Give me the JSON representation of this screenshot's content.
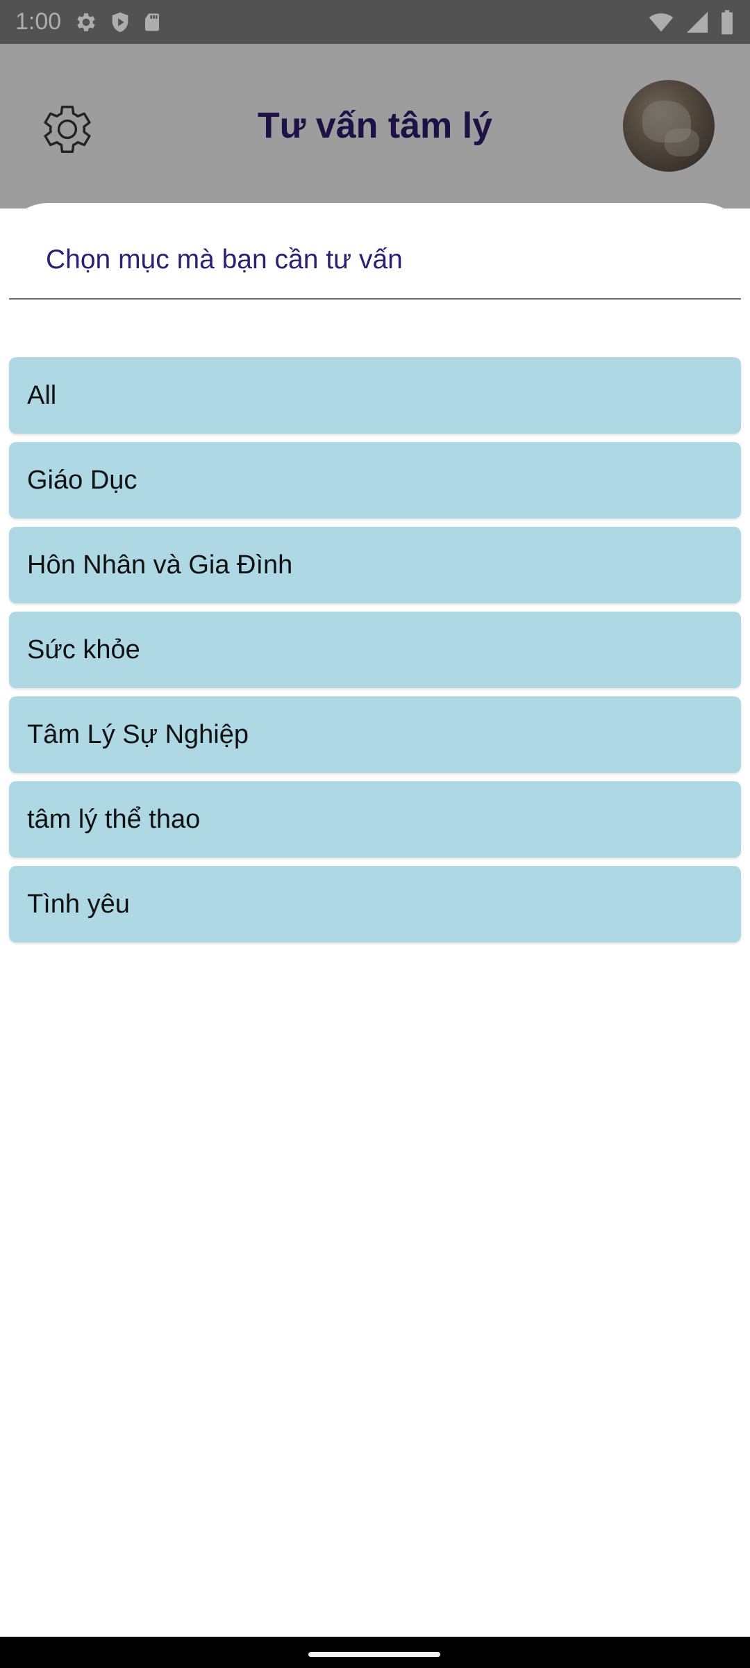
{
  "status_bar": {
    "time": "1:00",
    "left_icons": [
      "gear-icon",
      "shield-icon",
      "sd-card-icon"
    ],
    "right_icons": [
      "wifi-icon",
      "signal-icon",
      "battery-icon"
    ]
  },
  "app_bar": {
    "title": "Tư vấn tâm lý",
    "settings_icon": "gear-icon",
    "avatar": "profile-photo"
  },
  "sheet": {
    "header": "Chọn mục mà bạn cần tư vấn",
    "items": [
      {
        "label": "All"
      },
      {
        "label": "Giáo Dục"
      },
      {
        "label": "Hôn Nhân và Gia Đình"
      },
      {
        "label": "Sức khỏe"
      },
      {
        "label": "Tâm Lý Sự Nghiệp"
      },
      {
        "label": "tâm lý thể thao"
      },
      {
        "label": "Tình yêu"
      }
    ]
  },
  "colors": {
    "title": "#2a1b66",
    "header": "#2d1f72",
    "item_background": "#add8e4"
  }
}
